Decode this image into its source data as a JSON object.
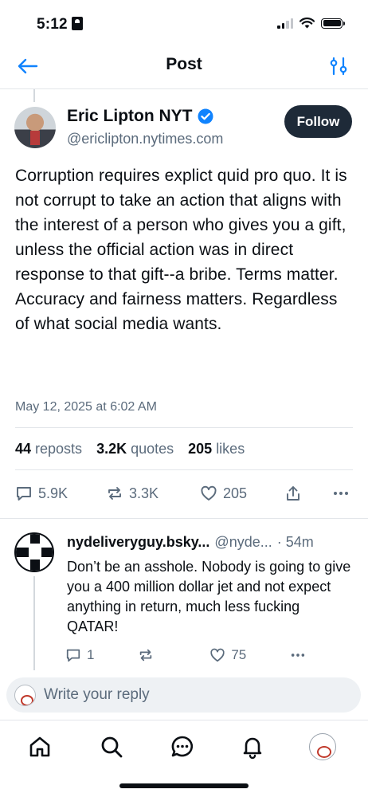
{
  "status_bar": {
    "time": "5:12"
  },
  "header": {
    "title": "Post"
  },
  "post": {
    "author_name": "Eric Lipton NYT",
    "author_handle": "@ericlipton.nytimes.com",
    "follow_label": "Follow",
    "text": "Corruption requires explict quid pro quo. It is not corrupt to take an action that aligns with the interest of a person who gives you a gift, unless the official action was in direct response to that gift--a bribe. Terms matter. Accuracy and fairness matters. Regardless of what social media wants.",
    "date": "May 12, 2025 at 6:02 AM",
    "stats": {
      "reposts_count": "44",
      "reposts_label": "reposts",
      "quotes_count": "3.2K",
      "quotes_label": "quotes",
      "likes_count": "205",
      "likes_label": "likes"
    },
    "actions": {
      "replies": "5.9K",
      "reposts": "3.3K",
      "likes": "205"
    }
  },
  "reply": {
    "name": "nydeliveryguy.bsky...",
    "handle": "@nyde...",
    "time": "· 54m",
    "text": "Don’t be an asshole. Nobody is going to give you a 400 million dollar jet and not expect anything in return, much less fucking QATAR!",
    "replies": "1",
    "likes": "75"
  },
  "composer": {
    "placeholder": "Write your reply"
  },
  "colors": {
    "accent": "#1083fe",
    "follow_bg": "#1e2a38",
    "muted": "#5b6b7c"
  }
}
